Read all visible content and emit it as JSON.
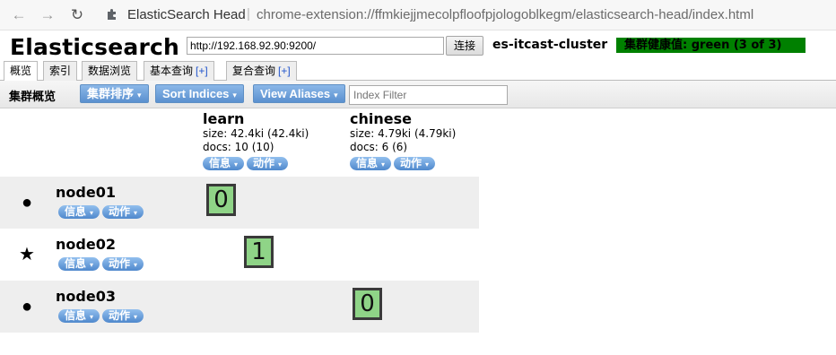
{
  "browser": {
    "back_glyph": "←",
    "forward_glyph": "→",
    "reload_glyph": "↻",
    "site_name": "ElasticSearch Head",
    "separator": "|",
    "url": "chrome-extension://ffmkiejjmecolpfloofpjologoblkegm/elasticsearch-head/index.html"
  },
  "header": {
    "title": "Elasticsearch",
    "connect_url": "http://192.168.92.90:9200/",
    "connect_label": "连接",
    "cluster_name": "es-itcast-cluster",
    "health_text": "集群健康值: green (3 of 3)",
    "health_color": "#008000"
  },
  "tabs": [
    {
      "label": "概览"
    },
    {
      "label": "索引"
    },
    {
      "label": "数据浏览"
    },
    {
      "label": "基本查询",
      "plus": "[+]"
    },
    {
      "label": "复合查询",
      "plus": "[+]"
    }
  ],
  "toolbar": {
    "title": "集群概览",
    "sort_label": "集群排序",
    "sort_indices_label": "Sort Indices",
    "view_aliases_label": "View Aliases",
    "filter_placeholder": "Index Filter",
    "caret": "▾"
  },
  "indices": [
    {
      "name": "learn",
      "size": "size: 42.4ki (42.4ki)",
      "docs": "docs: 10 (10)",
      "info_label": "信息",
      "action_label": "动作"
    },
    {
      "name": "chinese",
      "size": "size: 4.79ki (4.79ki)",
      "docs": "docs: 6 (6)",
      "info_label": "信息",
      "action_label": "动作"
    }
  ],
  "nodes": [
    {
      "name": "node01",
      "icon": "●",
      "info_label": "信息",
      "action_label": "动作",
      "shard": "0"
    },
    {
      "name": "node02",
      "icon": "★",
      "info_label": "信息",
      "action_label": "动作",
      "shard": "1"
    },
    {
      "name": "node03",
      "icon": "●",
      "info_label": "信息",
      "action_label": "动作",
      "shard": "0"
    }
  ]
}
